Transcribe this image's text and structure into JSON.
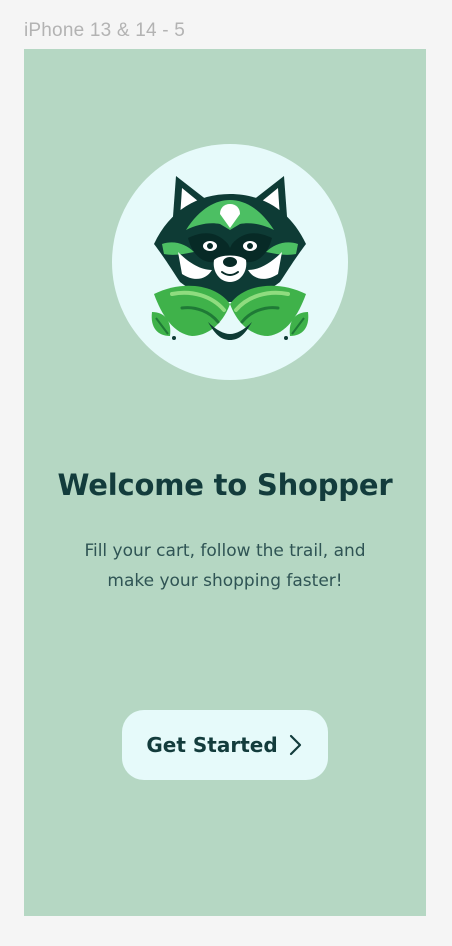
{
  "frame": {
    "label": "iPhone 13 & 14 - 5"
  },
  "welcome": {
    "title": "Welcome to Shopper",
    "subtitle": "Fill your cart, follow the trail, and make your shopping faster!",
    "cta_label": "Get Started",
    "cta_icon": "chevron-right-icon",
    "logo_icon": "raccoon-logo-icon"
  },
  "colors": {
    "page_background": "#f5f5f5",
    "screen_background": "#b5d7c3",
    "circle_background": "#e6fafa",
    "title_text": "#133c3c",
    "body_text": "#2f5454",
    "brand_green": "#3fb24a"
  }
}
